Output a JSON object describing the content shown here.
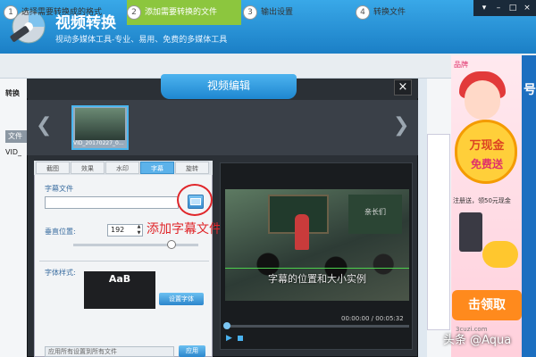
{
  "app": {
    "title": "视频转换",
    "subtitle": "视动多媒体工具-专业、易用、免费的多媒体工具"
  },
  "window_controls": [
    "menu-icon",
    "minimize-icon",
    "maximize-icon",
    "close-icon"
  ],
  "steps": [
    {
      "num": "1",
      "label": "选择需要转换成的格式"
    },
    {
      "num": "2",
      "label": "添加需要转换的文件"
    },
    {
      "num": "3",
      "label": "输出设置"
    },
    {
      "num": "4",
      "label": "转换文件"
    }
  ],
  "main": {
    "transform_label": "转换",
    "file_col_header": "文件",
    "file_row": "VID_"
  },
  "dialog": {
    "title": "视频编辑",
    "close_glyph": "×",
    "thumbnail_label": "VID_20170227_0...",
    "tabs": [
      "截图",
      "效果",
      "水印",
      "字幕",
      "旋转"
    ],
    "active_tab_index": 3,
    "subtitle_file_label": "字幕文件",
    "subtitle_file_value": "",
    "vertical_position_label": "垂直位置:",
    "vertical_position_value": "192",
    "font_style_label": "字体样式:",
    "font_preview_text": "AaB",
    "set_font_button": "设置字体",
    "apply_all_placeholder": "应用所有设置到所有文件",
    "apply_button": "应用"
  },
  "annotation": "添加字幕文件",
  "video": {
    "subtitle_text": "字幕的位置和大小实例",
    "board_text": "亲长们",
    "time_display": "00:00:00 / 00:05:32",
    "progress": 0.0
  },
  "ad": {
    "brand_text": "品牌",
    "coupon_line1": "万现金",
    "coupon_line2": "免费送",
    "promo_line": "注册送，领50元现金",
    "cta_button": "击领取",
    "url": "3cuzi.com",
    "side_char": "号"
  },
  "watermark": "头条 @Aqua",
  "colors": {
    "header_blue": "#1b7fc6",
    "active_step_green": "#8cc63e",
    "annotation_red": "#e0262a",
    "tab_active_blue": "#5cb2ea"
  }
}
